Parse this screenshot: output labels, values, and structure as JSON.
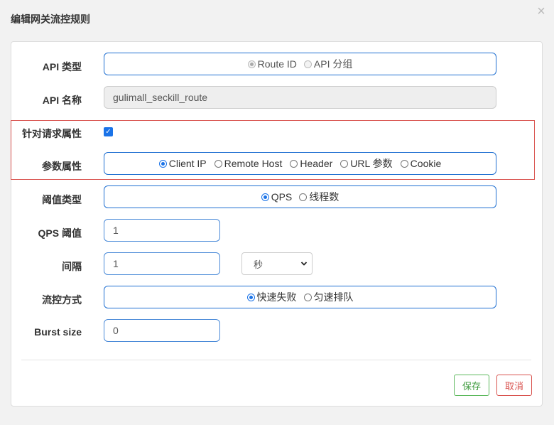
{
  "modal": {
    "title": "编辑网关流控规则",
    "close_glyph": "×"
  },
  "form": {
    "api_type": {
      "label": "API 类型",
      "options": [
        "Route ID",
        "API 分组"
      ],
      "selected": "Route ID",
      "disabled": true
    },
    "api_name": {
      "label": "API 名称",
      "value": "gulimall_seckill_route"
    },
    "per_request_attr": {
      "label": "针对请求属性",
      "checked": true
    },
    "param_attr": {
      "label": "参数属性",
      "options": [
        "Client IP",
        "Remote Host",
        "Header",
        "URL 参数",
        "Cookie"
      ],
      "selected": "Client IP"
    },
    "threshold_type": {
      "label": "阈值类型",
      "options": [
        "QPS",
        "线程数"
      ],
      "selected": "QPS"
    },
    "qps_threshold": {
      "label": "QPS 阈值",
      "value": "1"
    },
    "interval": {
      "label": "间隔",
      "value": "1",
      "unit": "秒"
    },
    "control_mode": {
      "label": "流控方式",
      "options": [
        "快速失败",
        "匀速排队"
      ],
      "selected": "快速失败"
    },
    "burst_size": {
      "label": "Burst size",
      "value": "0"
    }
  },
  "buttons": {
    "save": "保存",
    "cancel": "取消"
  },
  "colors": {
    "accent": "#1a73e8",
    "highlight_border": "#d9534f",
    "save": "#5cb85c",
    "cancel": "#d9534f"
  }
}
